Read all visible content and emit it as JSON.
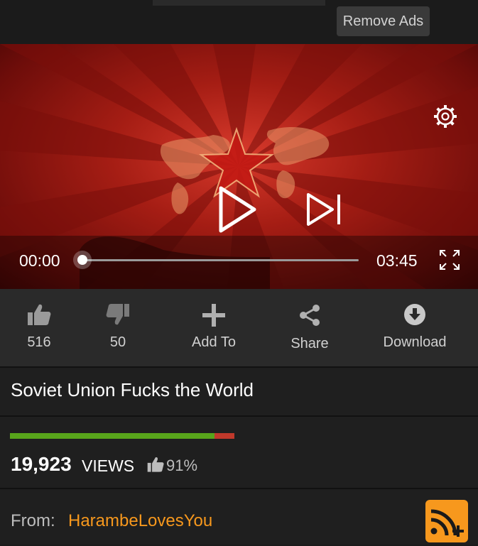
{
  "header": {
    "remove_ads_label": "Remove Ads"
  },
  "player": {
    "current_time": "00:00",
    "total_time": "03:45",
    "progress": 0
  },
  "actions": [
    {
      "label": "516",
      "icon": "thumbs-up-icon"
    },
    {
      "label": "50",
      "icon": "thumbs-down-icon"
    },
    {
      "label": "Add To",
      "icon": "plus-icon"
    },
    {
      "label": "Share",
      "icon": "share-icon"
    },
    {
      "label": "Download",
      "icon": "download-icon"
    }
  ],
  "video": {
    "title": "Soviet Union Fucks the World",
    "views": "19,923",
    "views_label": "VIEWS",
    "rating_percent": "91%",
    "rating_fraction": 0.91,
    "from_label": "From:",
    "uploader": "HarambeLovesYou"
  },
  "colors": {
    "accent": "#f7981d",
    "rating_good": "#58a51b",
    "rating_bad": "#c0392b"
  }
}
